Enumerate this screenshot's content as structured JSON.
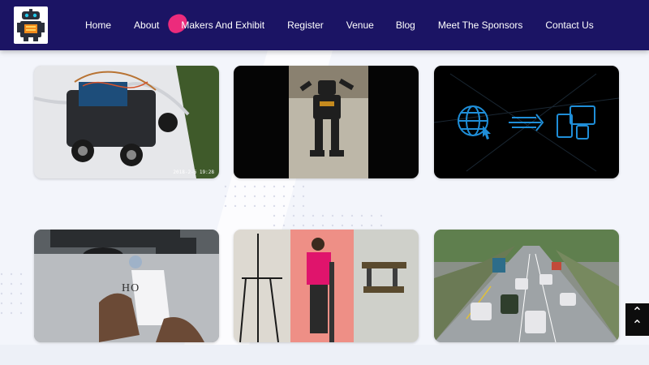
{
  "nav": {
    "items": [
      {
        "label": "Home"
      },
      {
        "label": "About"
      },
      {
        "label": "Makers And Exhibit"
      },
      {
        "label": "Register"
      },
      {
        "label": "Venue"
      },
      {
        "label": "Blog"
      },
      {
        "label": "Meet The Sponsors"
      },
      {
        "label": "Contact Us"
      }
    ],
    "accent_color": "#ec2b7c",
    "bar_color": "#1b1464"
  },
  "gallery": {
    "photo1": {
      "timestamp": "2018-2-6 19:28"
    },
    "photo4": {
      "card_text": "HO"
    }
  },
  "scroll_top": {
    "icon": "double-chevron-up-icon"
  }
}
